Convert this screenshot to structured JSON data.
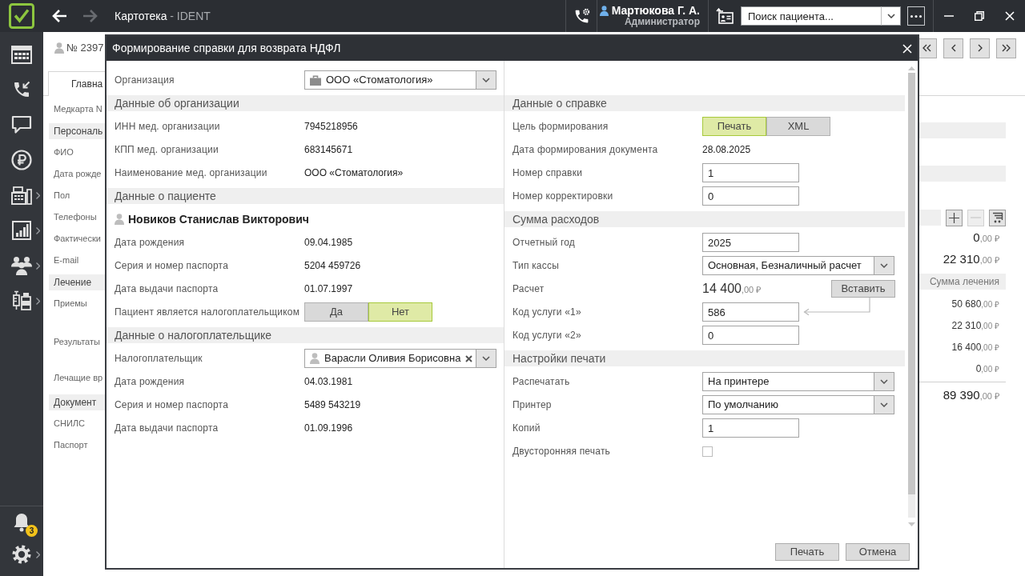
{
  "topbar": {
    "nav": [
      {
        "kind": "back",
        "disabled": false
      },
      {
        "kind": "forward",
        "disabled": true
      }
    ],
    "title": "Картотека",
    "subtitle": "- IDENT",
    "user": {
      "name": "Мартюкова Г. А.",
      "role": "Администратор"
    },
    "search": {
      "placeholder": "Поиск пациента..."
    }
  },
  "sidebar": {
    "items": [
      {
        "kind": "schedule",
        "submenu": false
      },
      {
        "kind": "calls",
        "submenu": false
      },
      {
        "kind": "messages",
        "submenu": false
      },
      {
        "kind": "payments",
        "submenu": false
      },
      {
        "kind": "cashbox",
        "submenu": true
      },
      {
        "kind": "reports",
        "submenu": true
      },
      {
        "kind": "patients",
        "submenu": true
      },
      {
        "kind": "pharmacy",
        "submenu": true
      }
    ],
    "bottom": [
      {
        "kind": "notifications",
        "badge": "3",
        "submenu": false
      },
      {
        "kind": "settings",
        "submenu": true
      }
    ]
  },
  "patient_card": {
    "number": "№ 2397",
    "record_nav": [
      {
        "kind": "first"
      },
      {
        "kind": "previous"
      },
      {
        "kind": "next"
      },
      {
        "kind": "last"
      }
    ],
    "tabs": [
      {
        "label": "Главна",
        "selected": true
      }
    ],
    "fields": [
      {
        "kind": "label",
        "text": "Медкарта N"
      },
      {
        "kind": "section",
        "text": "Персональ"
      },
      {
        "kind": "label",
        "text": "ФИО"
      },
      {
        "kind": "label",
        "text": "Дата рожде"
      },
      {
        "kind": "label",
        "text": "Пол"
      },
      {
        "kind": "label",
        "text": "Телефоны"
      },
      {
        "kind": "label",
        "text": "Фактически"
      },
      {
        "kind": "label",
        "text": "E-mail"
      },
      {
        "kind": "section",
        "text": "Лечение"
      },
      {
        "kind": "label",
        "text": "Приемы"
      },
      {
        "kind": "label",
        "text": "Результаты"
      },
      {
        "kind": "label",
        "text": "Лечащие вр"
      },
      {
        "kind": "section",
        "text": "Документ"
      },
      {
        "kind": "label",
        "text": "СНИЛС"
      },
      {
        "kind": "label",
        "text": "Паспорт"
      }
    ],
    "summary": [
      {
        "kind": "band"
      },
      {
        "kind": "band"
      },
      {
        "kind": "toolbar",
        "buttons": [
          {
            "kind": "add",
            "disabled": false
          },
          {
            "kind": "remove",
            "disabled": true
          },
          {
            "kind": "cart",
            "disabled": false
          }
        ]
      },
      {
        "kind": "big_amount",
        "value": "0",
        "cents": ",00 ₽"
      },
      {
        "kind": "big_amount",
        "value": "22 310",
        "cents": ",00 ₽"
      },
      {
        "kind": "header",
        "text": "Сумма лечения"
      },
      {
        "kind": "amount",
        "value": "50 680",
        "cents": ",00 ₽"
      },
      {
        "kind": "amount",
        "value": "22 310",
        "cents": ",00 ₽"
      },
      {
        "kind": "amount",
        "value": "16 400",
        "cents": ",00 ₽"
      },
      {
        "kind": "amount",
        "value": "0",
        "cents": ",00 ₽"
      },
      {
        "kind": "total",
        "value": "89 390",
        "cents": ",00 ₽"
      }
    ]
  },
  "dialog": {
    "title": "Формирование справки для возврата НДФЛ",
    "left": [
      {
        "kind": "org_select",
        "label": "Организация",
        "value": "ООО «Стоматология»"
      },
      {
        "kind": "section",
        "title": "Данные об организации"
      },
      {
        "kind": "text",
        "label": "ИНН мед. организации",
        "value": "7945218956"
      },
      {
        "kind": "text",
        "label": "КПП мед. организации",
        "value": "683145671"
      },
      {
        "kind": "text",
        "label": "Наименование мед. организации",
        "value": "ООО «Стоматология»"
      },
      {
        "kind": "section",
        "title": "Данные о пациенте"
      },
      {
        "kind": "person",
        "value": "Новиков Станислав Викторович"
      },
      {
        "kind": "text",
        "label": "Дата рождения",
        "value": "09.04.1985"
      },
      {
        "kind": "text",
        "label": "Серия и номер паспорта",
        "value": "5204 459726"
      },
      {
        "kind": "text",
        "label": "Дата выдачи паспорта",
        "value": "01.07.1997"
      },
      {
        "kind": "toggle",
        "label": "Пациент является налогоплательщиком",
        "options": [
          {
            "label": "Да",
            "selected": false
          },
          {
            "label": "Нет",
            "selected": true
          }
        ]
      },
      {
        "kind": "section",
        "title": "Данные о налогоплательщике"
      },
      {
        "kind": "person_select",
        "label": "Налогоплательщик",
        "value": "Варасли Оливия Борисовна",
        "clearable": true
      },
      {
        "kind": "text",
        "label": "Дата рождения",
        "value": "04.03.1981"
      },
      {
        "kind": "text",
        "label": "Серия и номер паспорта",
        "value": "5489 543219"
      },
      {
        "kind": "text",
        "label": "Дата выдачи паспорта",
        "value": "01.09.1996"
      }
    ],
    "right": [
      {
        "kind": "section",
        "title": "Данные о справке"
      },
      {
        "kind": "toggle",
        "label": "Цель формирования",
        "options": [
          {
            "label": "Печать",
            "selected": true
          },
          {
            "label": "XML",
            "selected": false
          }
        ]
      },
      {
        "kind": "text",
        "label": "Дата формирования документа",
        "value": "28.08.2025"
      },
      {
        "kind": "input",
        "label": "Номер справки",
        "value": "1"
      },
      {
        "kind": "input",
        "label": "Номер корректировки",
        "value": "0"
      },
      {
        "kind": "section",
        "title": "Сумма расходов"
      },
      {
        "kind": "input",
        "label": "Отчетный год",
        "value": "2025"
      },
      {
        "kind": "select",
        "label": "Тип кассы",
        "value": "Основная, Безналичный расчет"
      },
      {
        "kind": "amount",
        "label": "Расчет",
        "value": "14 400",
        "cents": ",00 ₽",
        "button": "Вставить"
      },
      {
        "kind": "input",
        "label": "Код услуги «1»",
        "value": "586",
        "arrow": true
      },
      {
        "kind": "input",
        "label": "Код услуги «2»",
        "value": "0"
      },
      {
        "kind": "section",
        "title": "Настройки печати"
      },
      {
        "kind": "select",
        "label": "Распечатать",
        "value": "На принтере"
      },
      {
        "kind": "select",
        "label": "Принтер",
        "value": "По умолчанию"
      },
      {
        "kind": "input",
        "label": "Копий",
        "value": "1"
      },
      {
        "kind": "checkbox",
        "label": "Двусторонняя печать",
        "checked": false
      }
    ],
    "buttons": [
      {
        "label": "Печать"
      },
      {
        "label": "Отмена"
      }
    ]
  }
}
